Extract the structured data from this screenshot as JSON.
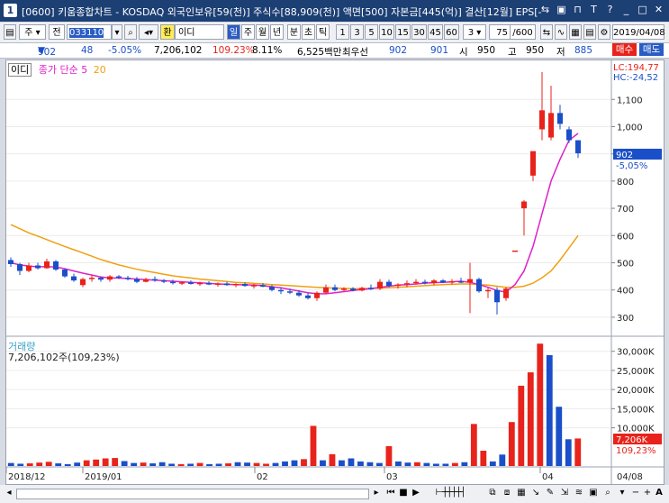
{
  "window": {
    "icon": "1",
    "title": "[0600] 키움종합차트 - KOSDAQ 외국인보유[59(천)] 주식수[88,909(천)] 액면[500] 자본금[445(억)] 결산[12월] EPS[-"
  },
  "toolbar": {
    "market": "주",
    "period_type": "전",
    "code": "033110",
    "stock_name": "이디",
    "currency_tag": "환",
    "periods": [
      "일",
      "주",
      "월",
      "년",
      "분",
      "초",
      "틱"
    ],
    "minutes": [
      "1",
      "3",
      "5",
      "10",
      "15",
      "30",
      "45",
      "60"
    ],
    "step": "3",
    "count": "75",
    "count_total": "/600",
    "date": "2019/04/08",
    "buy": "매수",
    "sell": "매도"
  },
  "quote": {
    "price": "902",
    "change": "48",
    "change_pct": "-5.05%",
    "volume": "7,206,102",
    "vol_ratio": "109.23%",
    "turnover": "8.11%",
    "amount": "6,525백만",
    "bid_label": "최우선",
    "bid1": "902",
    "bid2": "901",
    "open_label": "시",
    "open": "950",
    "high_label": "고",
    "high": "950",
    "low_label": "저",
    "low": "885"
  },
  "legend": {
    "name": "이디",
    "ma_label": "종가 단순",
    "ma5": "5",
    "ma20": "20",
    "volume_name": "거래량",
    "volume_value": "7,206,102주(109,23%)"
  },
  "price_axis": {
    "lc": "LC:194,77",
    "hc": "HC:-24,52",
    "ticks": [
      "1,100",
      "1,000",
      "900",
      "800",
      "700",
      "600",
      "500",
      "400",
      "300"
    ],
    "current": "902",
    "current_pct": "-5,05%"
  },
  "volume_axis": {
    "ticks": [
      "30,000K",
      "25,000K",
      "20,000K",
      "15,000K",
      "10,000K"
    ],
    "current": "7,206K",
    "current_pct": "109,23%"
  },
  "x_axis": {
    "labels": [
      "2018/12",
      "2019/01",
      "02",
      "03",
      "04"
    ],
    "end_label": "04/08"
  },
  "colors": {
    "up": "#e8231b",
    "down": "#1a4fc9",
    "ma5": "#e020c8",
    "ma20": "#f0a010"
  },
  "chart_data": {
    "type": "candlestick",
    "ylim": [
      250,
      1230
    ],
    "candles": [
      {
        "o": 510,
        "h": 520,
        "l": 485,
        "c": 495
      },
      {
        "o": 495,
        "h": 500,
        "l": 455,
        "c": 470
      },
      {
        "o": 470,
        "h": 500,
        "l": 465,
        "c": 490
      },
      {
        "o": 490,
        "h": 500,
        "l": 475,
        "c": 480
      },
      {
        "o": 480,
        "h": 515,
        "l": 478,
        "c": 505
      },
      {
        "o": 505,
        "h": 510,
        "l": 470,
        "c": 475
      },
      {
        "o": 475,
        "h": 480,
        "l": 445,
        "c": 450
      },
      {
        "o": 450,
        "h": 460,
        "l": 430,
        "c": 435
      },
      {
        "o": 418,
        "h": 445,
        "l": 410,
        "c": 440
      },
      {
        "o": 440,
        "h": 455,
        "l": 430,
        "c": 445
      },
      {
        "o": 445,
        "h": 450,
        "l": 430,
        "c": 438
      },
      {
        "o": 438,
        "h": 455,
        "l": 430,
        "c": 450
      },
      {
        "o": 450,
        "h": 455,
        "l": 440,
        "c": 445
      },
      {
        "o": 445,
        "h": 452,
        "l": 435,
        "c": 440
      },
      {
        "o": 440,
        "h": 448,
        "l": 425,
        "c": 430
      },
      {
        "o": 430,
        "h": 445,
        "l": 428,
        "c": 440
      },
      {
        "o": 440,
        "h": 450,
        "l": 430,
        "c": 435
      },
      {
        "o": 435,
        "h": 440,
        "l": 425,
        "c": 430
      },
      {
        "o": 430,
        "h": 438,
        "l": 420,
        "c": 425
      },
      {
        "o": 425,
        "h": 432,
        "l": 418,
        "c": 428
      },
      {
        "o": 428,
        "h": 435,
        "l": 420,
        "c": 422
      },
      {
        "o": 422,
        "h": 430,
        "l": 415,
        "c": 426
      },
      {
        "o": 426,
        "h": 432,
        "l": 418,
        "c": 420
      },
      {
        "o": 420,
        "h": 428,
        "l": 412,
        "c": 424
      },
      {
        "o": 424,
        "h": 430,
        "l": 415,
        "c": 418
      },
      {
        "o": 418,
        "h": 425,
        "l": 410,
        "c": 422
      },
      {
        "o": 422,
        "h": 428,
        "l": 412,
        "c": 415
      },
      {
        "o": 415,
        "h": 422,
        "l": 405,
        "c": 418
      },
      {
        "o": 418,
        "h": 425,
        "l": 410,
        "c": 412
      },
      {
        "o": 412,
        "h": 418,
        "l": 395,
        "c": 400
      },
      {
        "o": 400,
        "h": 410,
        "l": 385,
        "c": 395
      },
      {
        "o": 395,
        "h": 405,
        "l": 385,
        "c": 390
      },
      {
        "o": 390,
        "h": 400,
        "l": 375,
        "c": 380
      },
      {
        "o": 380,
        "h": 390,
        "l": 365,
        "c": 370
      },
      {
        "o": 370,
        "h": 395,
        "l": 360,
        "c": 390
      },
      {
        "o": 390,
        "h": 420,
        "l": 385,
        "c": 410
      },
      {
        "o": 410,
        "h": 420,
        "l": 395,
        "c": 400
      },
      {
        "o": 400,
        "h": 410,
        "l": 395,
        "c": 405
      },
      {
        "o": 405,
        "h": 410,
        "l": 395,
        "c": 398
      },
      {
        "o": 398,
        "h": 412,
        "l": 395,
        "c": 408
      },
      {
        "o": 408,
        "h": 420,
        "l": 400,
        "c": 405
      },
      {
        "o": 405,
        "h": 440,
        "l": 400,
        "c": 430
      },
      {
        "o": 430,
        "h": 438,
        "l": 410,
        "c": 415
      },
      {
        "o": 415,
        "h": 425,
        "l": 405,
        "c": 420
      },
      {
        "o": 420,
        "h": 435,
        "l": 410,
        "c": 425
      },
      {
        "o": 425,
        "h": 440,
        "l": 420,
        "c": 430
      },
      {
        "o": 430,
        "h": 438,
        "l": 420,
        "c": 425
      },
      {
        "o": 425,
        "h": 440,
        "l": 418,
        "c": 435
      },
      {
        "o": 435,
        "h": 440,
        "l": 425,
        "c": 428
      },
      {
        "o": 428,
        "h": 440,
        "l": 420,
        "c": 432
      },
      {
        "o": 432,
        "h": 445,
        "l": 425,
        "c": 428
      },
      {
        "o": 428,
        "h": 500,
        "l": 315,
        "c": 440
      },
      {
        "o": 440,
        "h": 445,
        "l": 390,
        "c": 395
      },
      {
        "o": 395,
        "h": 410,
        "l": 370,
        "c": 400
      },
      {
        "o": 400,
        "h": 410,
        "l": 310,
        "c": 355
      },
      {
        "o": 370,
        "h": 410,
        "l": 360,
        "c": 405
      },
      {
        "o": 545,
        "h": 545,
        "l": 545,
        "c": 545
      },
      {
        "o": 700,
        "h": 730,
        "l": 600,
        "c": 725
      },
      {
        "o": 820,
        "h": 900,
        "l": 800,
        "c": 910
      },
      {
        "o": 990,
        "h": 1200,
        "l": 950,
        "c": 1060
      },
      {
        "o": 960,
        "h": 1150,
        "l": 950,
        "c": 1050
      },
      {
        "o": 1050,
        "h": 1080,
        "l": 990,
        "c": 1010
      },
      {
        "o": 990,
        "h": 1000,
        "l": 940,
        "c": 950
      },
      {
        "o": 950,
        "h": 950,
        "l": 885,
        "c": 902
      }
    ],
    "ma5": [
      500,
      492,
      488,
      485,
      486,
      484,
      478,
      470,
      462,
      455,
      448,
      444,
      444,
      442,
      440,
      438,
      436,
      434,
      432,
      430,
      428,
      426,
      424,
      422,
      421,
      420,
      419,
      418,
      416,
      412,
      408,
      402,
      396,
      390,
      386,
      386,
      390,
      394,
      398,
      402,
      405,
      410,
      414,
      418,
      420,
      422,
      425,
      427,
      428,
      430,
      432,
      428,
      420,
      410,
      398,
      392,
      420,
      470,
      560,
      680,
      800,
      880,
      950,
      975
    ],
    "ma20": [
      640,
      625,
      610,
      598,
      585,
      572,
      560,
      548,
      536,
      524,
      512,
      502,
      492,
      484,
      476,
      470,
      464,
      458,
      452,
      448,
      444,
      440,
      437,
      434,
      431,
      428,
      426,
      424,
      422,
      420,
      418,
      416,
      414,
      412,
      410,
      408,
      407,
      406,
      405,
      405,
      406,
      407,
      408,
      410,
      412,
      414,
      416,
      418,
      420,
      421,
      422,
      422,
      420,
      418,
      414,
      410,
      410,
      414,
      425,
      445,
      470,
      510,
      555,
      600
    ]
  },
  "volume_data": {
    "ylim": [
      0,
      33000
    ],
    "bars": [
      {
        "v": 800,
        "up": false
      },
      {
        "v": 600,
        "up": false
      },
      {
        "v": 700,
        "up": true
      },
      {
        "v": 900,
        "up": true
      },
      {
        "v": 1100,
        "up": true
      },
      {
        "v": 700,
        "up": false
      },
      {
        "v": 500,
        "up": false
      },
      {
        "v": 900,
        "up": false
      },
      {
        "v": 1500,
        "up": true
      },
      {
        "v": 1700,
        "up": true
      },
      {
        "v": 2000,
        "up": true
      },
      {
        "v": 2100,
        "up": true
      },
      {
        "v": 1300,
        "up": false
      },
      {
        "v": 800,
        "up": false
      },
      {
        "v": 900,
        "up": true
      },
      {
        "v": 700,
        "up": false
      },
      {
        "v": 1000,
        "up": false
      },
      {
        "v": 600,
        "up": false
      },
      {
        "v": 500,
        "up": true
      },
      {
        "v": 600,
        "up": false
      },
      {
        "v": 800,
        "up": true
      },
      {
        "v": 500,
        "up": false
      },
      {
        "v": 600,
        "up": false
      },
      {
        "v": 700,
        "up": true
      },
      {
        "v": 1000,
        "up": false
      },
      {
        "v": 900,
        "up": false
      },
      {
        "v": 800,
        "up": true
      },
      {
        "v": 600,
        "up": true
      },
      {
        "v": 800,
        "up": false
      },
      {
        "v": 1200,
        "up": false
      },
      {
        "v": 1500,
        "up": false
      },
      {
        "v": 1800,
        "up": true
      },
      {
        "v": 10500,
        "up": true
      },
      {
        "v": 1500,
        "up": false
      },
      {
        "v": 3100,
        "up": true
      },
      {
        "v": 1500,
        "up": false
      },
      {
        "v": 2000,
        "up": false
      },
      {
        "v": 1200,
        "up": false
      },
      {
        "v": 1000,
        "up": false
      },
      {
        "v": 800,
        "up": false
      },
      {
        "v": 5200,
        "up": true
      },
      {
        "v": 1200,
        "up": false
      },
      {
        "v": 900,
        "up": false
      },
      {
        "v": 1000,
        "up": true
      },
      {
        "v": 800,
        "up": false
      },
      {
        "v": 600,
        "up": false
      },
      {
        "v": 600,
        "up": false
      },
      {
        "v": 800,
        "up": true
      },
      {
        "v": 1000,
        "up": false
      },
      {
        "v": 11000,
        "up": true
      },
      {
        "v": 4000,
        "up": true
      },
      {
        "v": 1200,
        "up": false
      },
      {
        "v": 3000,
        "up": false
      },
      {
        "v": 11500,
        "up": true
      },
      {
        "v": 21000,
        "up": true
      },
      {
        "v": 24500,
        "up": true
      },
      {
        "v": 32000,
        "up": true
      },
      {
        "v": 29000,
        "up": false
      },
      {
        "v": 15500,
        "up": false
      },
      {
        "v": 7000,
        "up": false
      },
      {
        "v": 7206,
        "up": true
      }
    ]
  }
}
